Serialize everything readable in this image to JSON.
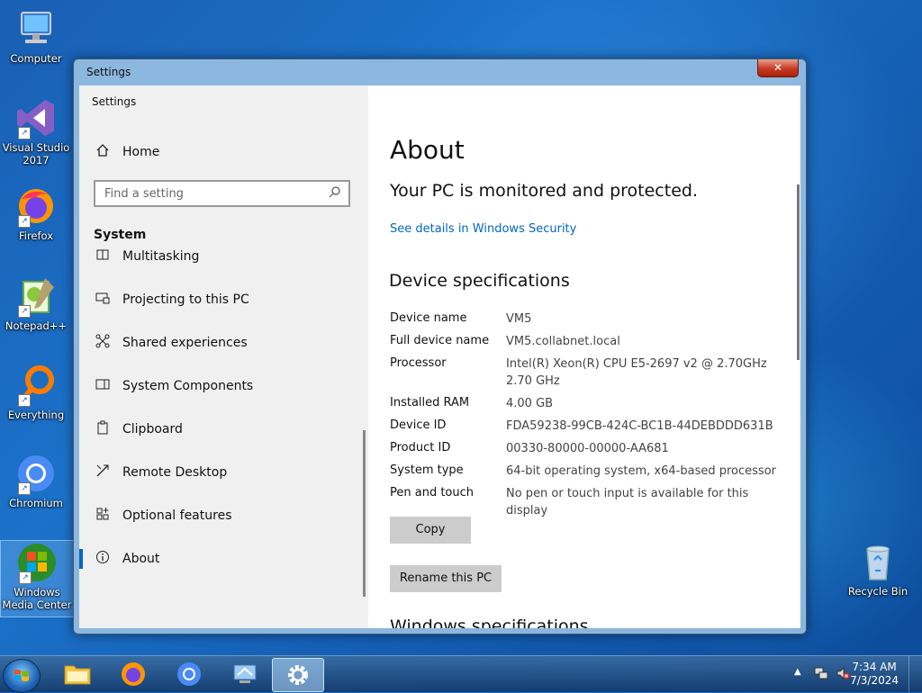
{
  "desktop": {
    "icons": [
      {
        "label": "Computer"
      },
      {
        "label": "Visual Studio 2017"
      },
      {
        "label": "Firefox"
      },
      {
        "label": "Notepad++"
      },
      {
        "label": "Everything"
      },
      {
        "label": "Chromium"
      },
      {
        "label": "Windows Media Center"
      },
      {
        "label": "Recycle Bin"
      }
    ]
  },
  "window": {
    "title": "Settings",
    "close_label": "✕"
  },
  "nav": {
    "app_title": "Settings",
    "home_label": "Home",
    "search_placeholder": "Find a setting",
    "section_header": "System",
    "items": [
      {
        "label": "Multitasking",
        "icon": "multitasking-icon"
      },
      {
        "label": "Projecting to this PC",
        "icon": "projecting-icon"
      },
      {
        "label": "Shared experiences",
        "icon": "shared-experiences-icon"
      },
      {
        "label": "System Components",
        "icon": "system-components-icon"
      },
      {
        "label": "Clipboard",
        "icon": "clipboard-icon"
      },
      {
        "label": "Remote Desktop",
        "icon": "remote-desktop-icon"
      },
      {
        "label": "Optional features",
        "icon": "optional-features-icon"
      },
      {
        "label": "About",
        "icon": "info-icon"
      }
    ],
    "active_item": "About"
  },
  "content": {
    "title": "About",
    "protection_status": "Your PC is monitored and protected.",
    "security_link": "See details in Windows Security",
    "device_spec_heading": "Device specifications",
    "specs": [
      {
        "label": "Device name",
        "value": "VM5"
      },
      {
        "label": "Full device name",
        "value": "VM5.collabnet.local"
      },
      {
        "label": "Processor",
        "value": "Intel(R) Xeon(R) CPU E5-2697 v2 @ 2.70GHz 2.70 GHz"
      },
      {
        "label": "Installed RAM",
        "value": "4.00 GB"
      },
      {
        "label": "Device ID",
        "value": "FDA59238-99CB-424C-BC1B-44DEBDDD631B"
      },
      {
        "label": "Product ID",
        "value": "00330-80000-00000-AA681"
      },
      {
        "label": "System type",
        "value": "64-bit operating system, x64-based processor"
      },
      {
        "label": "Pen and touch",
        "value": "No pen or touch input is available for this display"
      }
    ],
    "copy_button": "Copy",
    "rename_button": "Rename this PC",
    "next_heading_partial": "Windows specifications"
  },
  "taskbar": {
    "pinned": [
      {
        "name": "file-explorer"
      },
      {
        "name": "firefox"
      },
      {
        "name": "chromium"
      },
      {
        "name": "remote-desktop"
      },
      {
        "name": "settings",
        "active": true
      }
    ],
    "time": "7:34 AM",
    "date": "7/3/2024"
  }
}
